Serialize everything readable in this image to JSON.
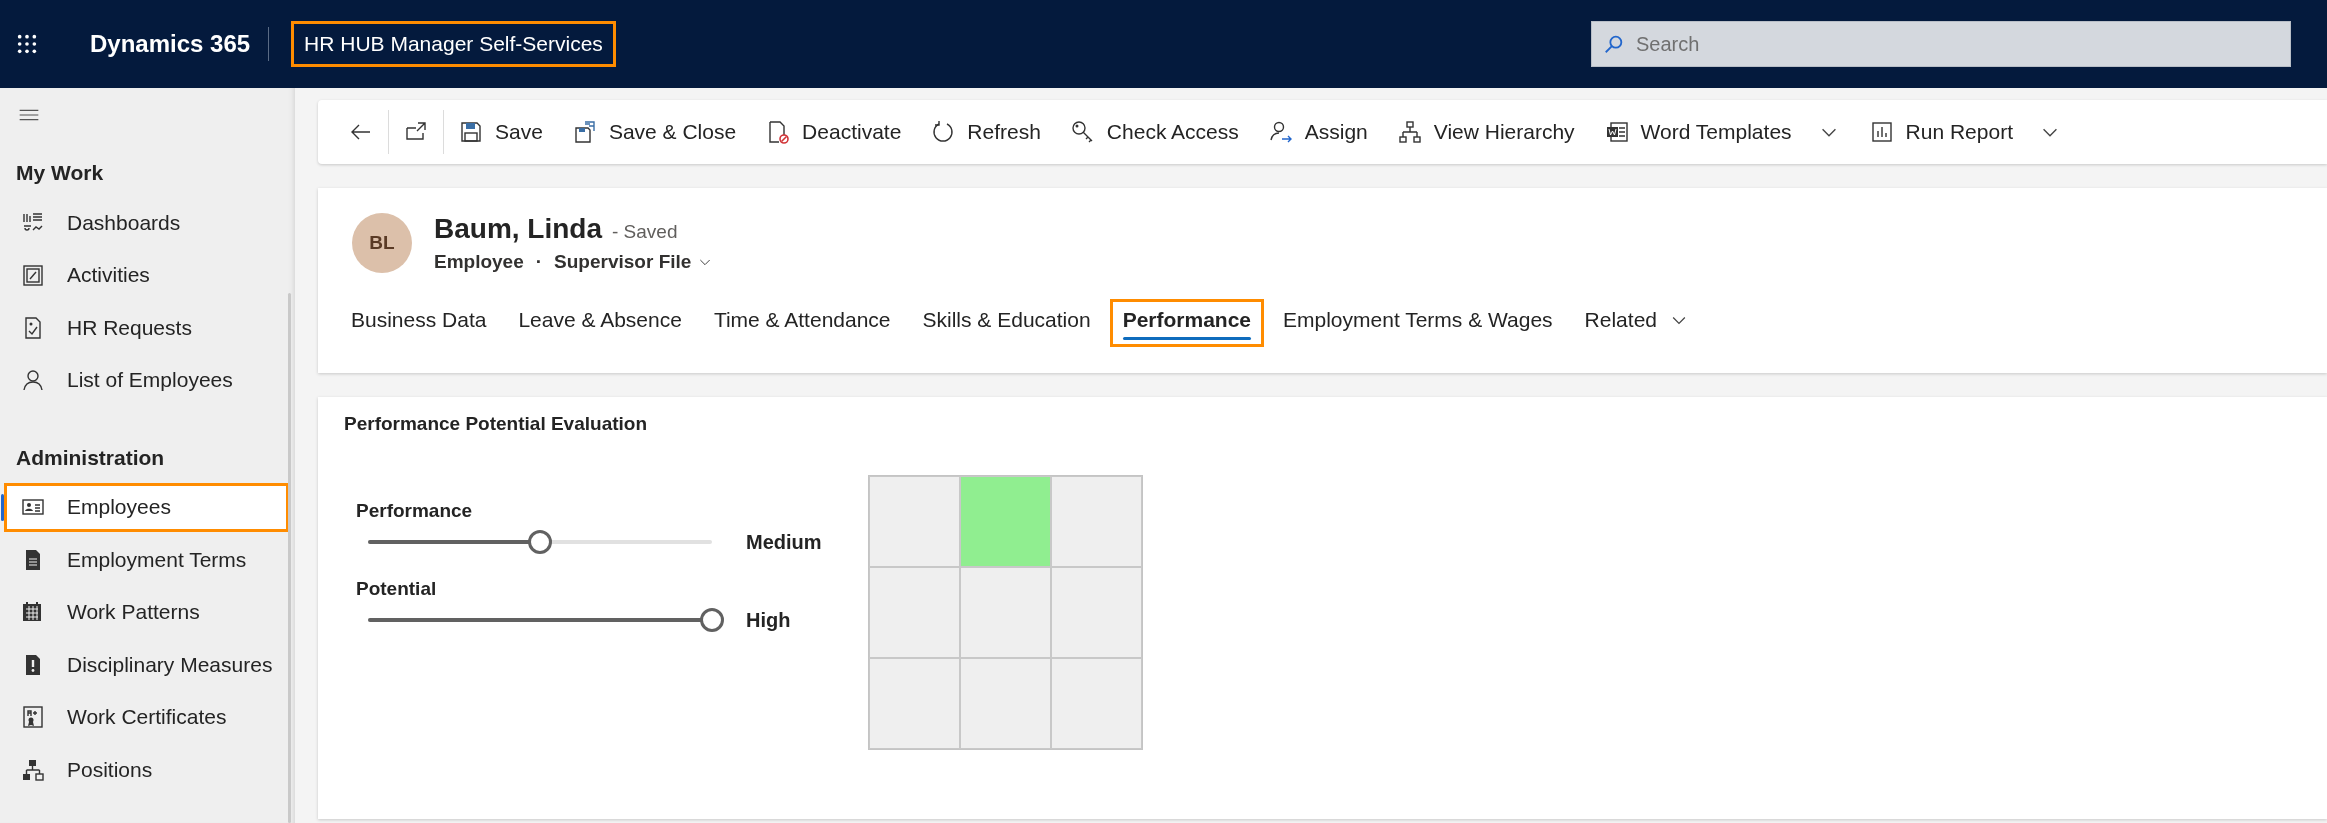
{
  "top_bar": {
    "app_name": "Dynamics 365",
    "app_title": "HR HUB Manager Self-Services",
    "app_title_highlighted": true,
    "search": {
      "placeholder": "Search"
    }
  },
  "sidebar": {
    "sections": [
      {
        "title": "My Work",
        "items": [
          {
            "label": "Dashboards",
            "selected": false,
            "highlighted": false
          },
          {
            "label": "Activities",
            "selected": false,
            "highlighted": false
          },
          {
            "label": "HR Requests",
            "selected": false,
            "highlighted": false
          },
          {
            "label": "List of Employees",
            "selected": false,
            "highlighted": false
          }
        ]
      },
      {
        "title": "Administration",
        "items": [
          {
            "label": "Employees",
            "selected": true,
            "highlighted": true
          },
          {
            "label": "Employment Terms",
            "selected": false,
            "highlighted": false
          },
          {
            "label": "Work Patterns",
            "selected": false,
            "highlighted": false
          },
          {
            "label": "Disciplinary Measures",
            "selected": false,
            "highlighted": false
          },
          {
            "label": "Work Certificates",
            "selected": false,
            "highlighted": false
          },
          {
            "label": "Positions",
            "selected": false,
            "highlighted": false
          }
        ]
      }
    ]
  },
  "command_bar": {
    "commands": [
      {
        "label": "Save",
        "has_menu": false
      },
      {
        "label": "Save & Close",
        "has_menu": false
      },
      {
        "label": "Deactivate",
        "has_menu": false
      },
      {
        "label": "Refresh",
        "has_menu": false
      },
      {
        "label": "Check Access",
        "has_menu": false
      },
      {
        "label": "Assign",
        "has_menu": false
      },
      {
        "label": "View Hierarchy",
        "has_menu": false
      },
      {
        "label": "Word Templates",
        "has_menu": true
      },
      {
        "label": "Run Report",
        "has_menu": true
      }
    ]
  },
  "record": {
    "initials": "BL",
    "name": "Baum, Linda",
    "status": "- Saved",
    "entity": "Employee",
    "separator": "·",
    "form": "Supervisor File"
  },
  "tabs": [
    {
      "label": "Business Data",
      "selected": false,
      "highlighted": false,
      "has_menu": false
    },
    {
      "label": "Leave & Absence",
      "selected": false,
      "highlighted": false,
      "has_menu": false
    },
    {
      "label": "Time & Attendance",
      "selected": false,
      "highlighted": false,
      "has_menu": false
    },
    {
      "label": "Skills & Education",
      "selected": false,
      "highlighted": false,
      "has_menu": false
    },
    {
      "label": "Performance",
      "selected": true,
      "highlighted": true,
      "has_menu": false
    },
    {
      "label": "Employment Terms & Wages",
      "selected": false,
      "highlighted": false,
      "has_menu": false
    },
    {
      "label": "Related",
      "selected": false,
      "highlighted": false,
      "has_menu": true
    }
  ],
  "section": {
    "title": "Performance Potential Evaluation",
    "sliders": [
      {
        "label": "Performance",
        "level": 0.5,
        "reading": "Medium"
      },
      {
        "label": "Potential",
        "level": 1.0,
        "reading": "High"
      }
    ],
    "grid": {
      "rows": [
        {
          "cells": [
            {
              "filled": false
            },
            {
              "filled": true
            },
            {
              "filled": false
            }
          ]
        },
        {
          "cells": [
            {
              "filled": false
            },
            {
              "filled": false
            },
            {
              "filled": false
            }
          ]
        },
        {
          "cells": [
            {
              "filled": false
            },
            {
              "filled": false
            },
            {
              "filled": false
            }
          ]
        }
      ]
    }
  }
}
